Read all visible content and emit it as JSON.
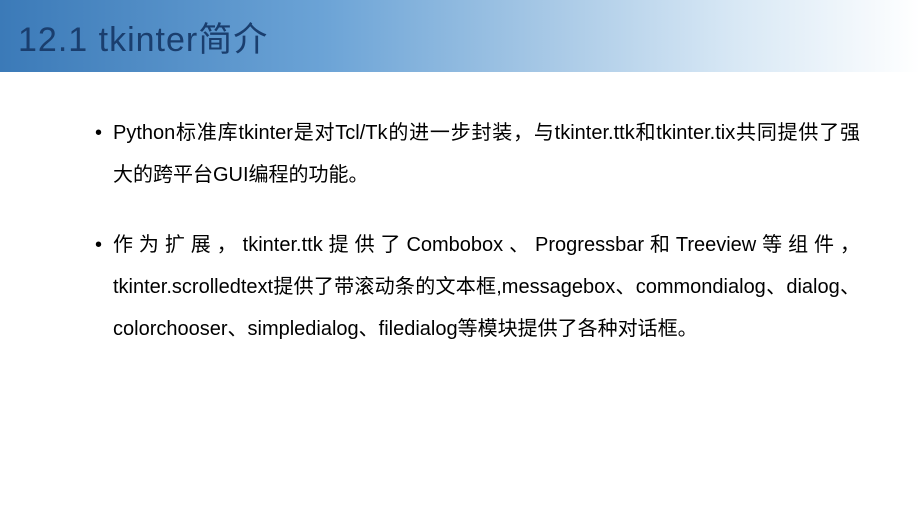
{
  "header": {
    "title": "12.1  tkinter简介"
  },
  "bullets": [
    "Python标准库tkinter是对Tcl/Tk的进一步封装，与tkinter.ttk和tkinter.tix共同提供了强大的跨平台GUI编程的功能。",
    "作为扩展，tkinter.ttk提供了Combobox、Progressbar和Treeview等组件，tkinter.scrolledtext提供了带滚动条的文本框,messagebox、commondialog、dialog、colorchooser、simpledialog、filedialog等模块提供了各种对话框。"
  ]
}
